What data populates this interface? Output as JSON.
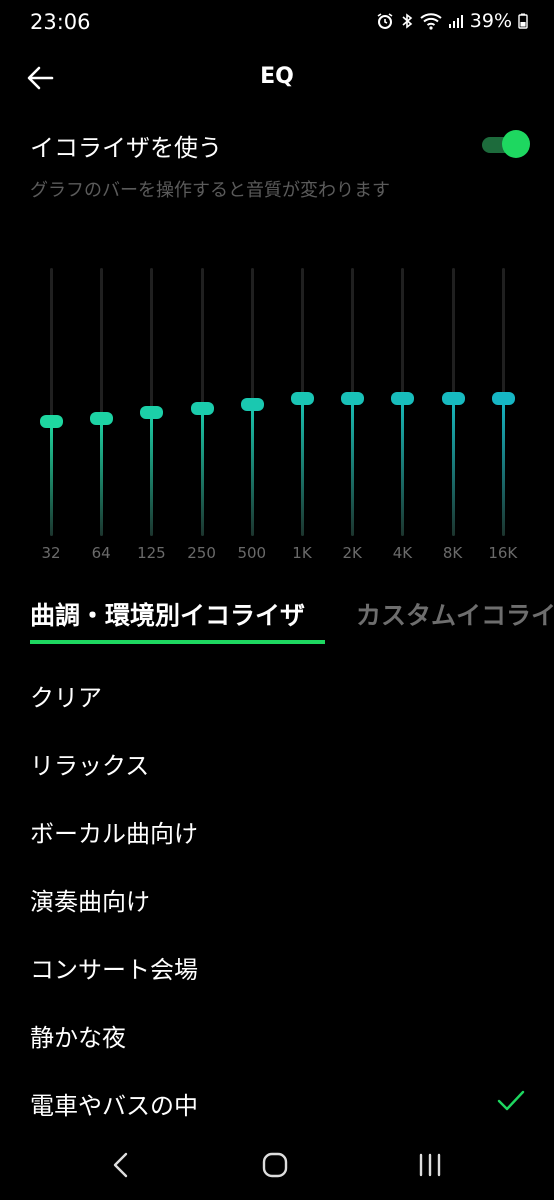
{
  "status_bar": {
    "time": "23:06",
    "battery": "39%",
    "icons": [
      "alarm-icon",
      "bluetooth-icon",
      "wifi-icon",
      "signal-icon",
      "battery-icon"
    ]
  },
  "header": {
    "title": "EQ",
    "back_icon": "arrow-left-icon"
  },
  "equalizer": {
    "toggle_label": "イコライザを使う",
    "enabled": true,
    "hint": "グラフのバーを操作すると音質が変わります",
    "bands": [
      {
        "label": "32",
        "level": 0.425
      },
      {
        "label": "64",
        "level": 0.438
      },
      {
        "label": "125",
        "level": 0.46
      },
      {
        "label": "250",
        "level": 0.474
      },
      {
        "label": "500",
        "level": 0.49
      },
      {
        "label": "1K",
        "level": 0.512
      },
      {
        "label": "2K",
        "level": 0.512
      },
      {
        "label": "4K",
        "level": 0.512
      },
      {
        "label": "8K",
        "level": 0.512
      },
      {
        "label": "16K",
        "level": 0.512
      }
    ]
  },
  "tabs": [
    {
      "label": "曲調・環境別イコライザ",
      "active": true
    },
    {
      "label": "カスタムイコライザ",
      "active": false
    }
  ],
  "presets": [
    {
      "label": "クリア",
      "selected": false
    },
    {
      "label": "リラックス",
      "selected": false
    },
    {
      "label": "ボーカル曲向け",
      "selected": false
    },
    {
      "label": "演奏曲向け",
      "selected": false
    },
    {
      "label": "コンサート会場",
      "selected": false
    },
    {
      "label": "静かな夜",
      "selected": false
    },
    {
      "label": "電車やバスの中",
      "selected": true
    }
  ],
  "colors": {
    "accent": "#1ed760",
    "knob_low": "#1ed7a0",
    "knob_high": "#16b6c4",
    "background": "#000000"
  }
}
